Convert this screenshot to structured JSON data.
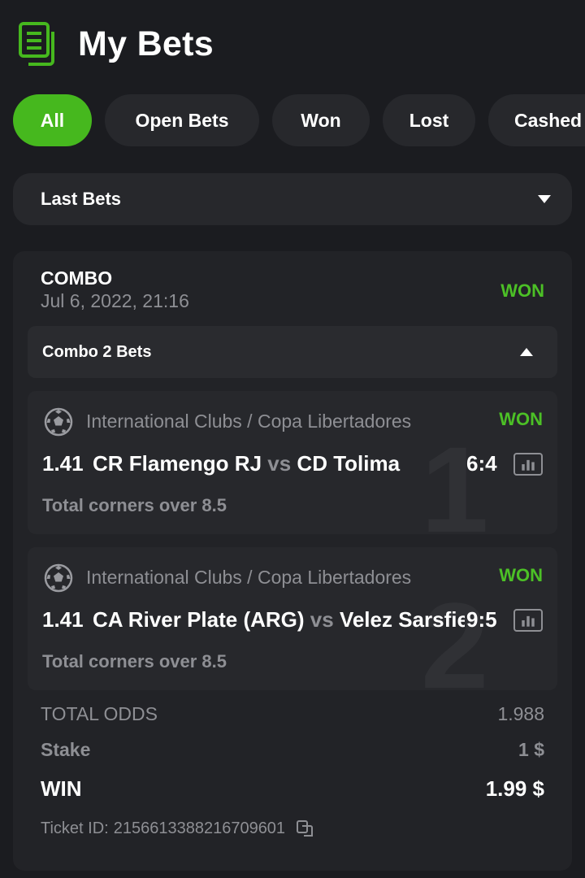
{
  "header": {
    "title": "My Bets",
    "icon": "bet-slip-icon"
  },
  "tabs": [
    {
      "label": "All",
      "active": true
    },
    {
      "label": "Open Bets",
      "active": false
    },
    {
      "label": "Won",
      "active": false
    },
    {
      "label": "Lost",
      "active": false
    },
    {
      "label": "Cashed Out",
      "active": false
    }
  ],
  "filter": {
    "selected": "Last Bets"
  },
  "bet": {
    "type": "COMBO",
    "date": "Jul 6, 2022, 21:16",
    "status": "WON",
    "combo_label": "Combo 2 Bets",
    "legs": [
      {
        "number": "1",
        "league": "International Clubs / Copa Libertadores",
        "status": "WON",
        "odds": "1.41",
        "home": "CR Flamengo RJ",
        "vs": "vs",
        "away": "CD Tolima",
        "score": "6:4",
        "market": "Total corners over 8.5"
      },
      {
        "number": "2",
        "league": "International Clubs / Copa Libertadores",
        "status": "WON",
        "odds": "1.41",
        "home": "CA River Plate (ARG)",
        "vs": "vs",
        "away": "Velez Sarsfield",
        "score": "9:5",
        "market": "Total corners over 8.5"
      }
    ],
    "total_odds_label": "TOTAL ODDS",
    "total_odds": "1.988",
    "stake_label": "Stake",
    "stake": "1 $",
    "win_label": "WIN",
    "win": "1.99 $",
    "ticket_label": "Ticket ID:",
    "ticket_id": "2156613388216709601"
  },
  "colors": {
    "accent": "#46b81e",
    "won": "#4cc026",
    "background": "#1b1c20",
    "card": "#222327"
  }
}
